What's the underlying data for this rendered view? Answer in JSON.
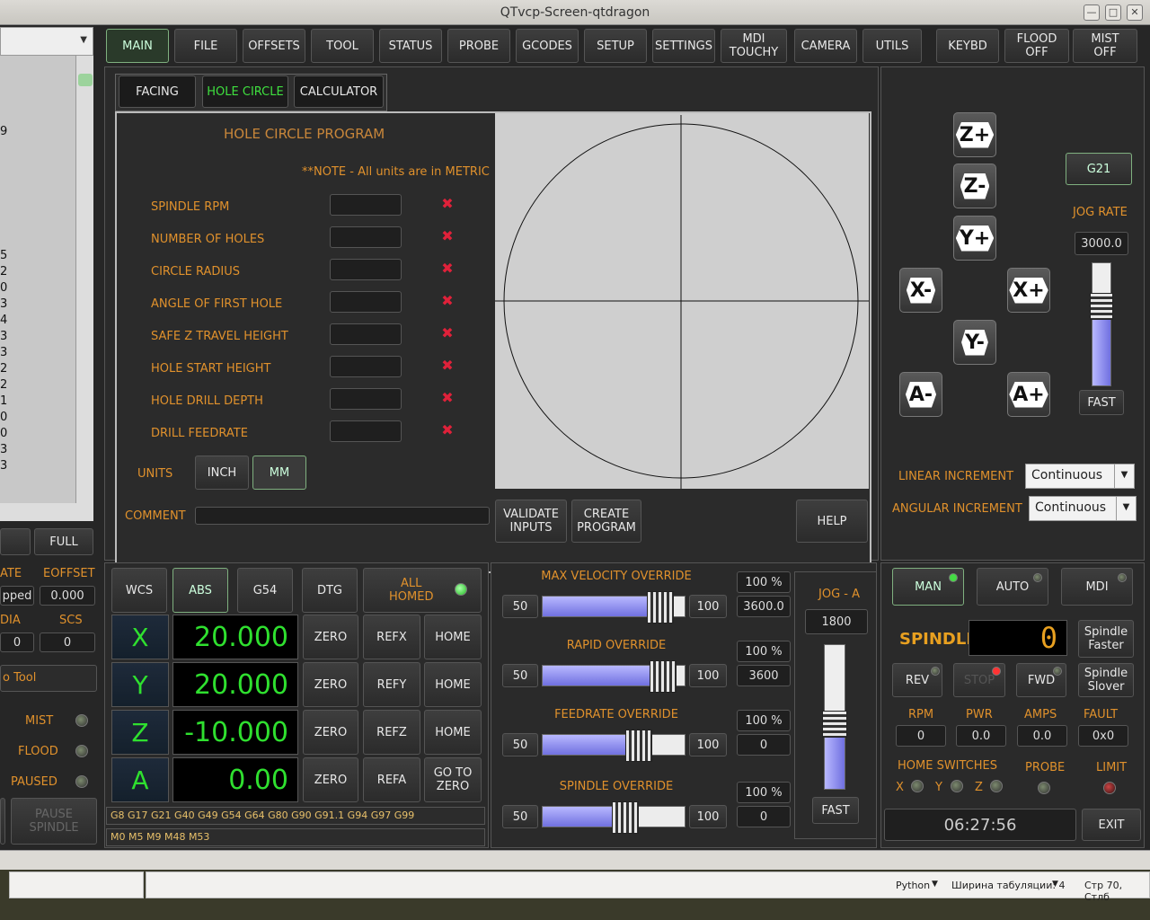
{
  "window": {
    "title": "QTvcp-Screen-qtdragon",
    "min": "—",
    "max": "□",
    "close": "✕"
  },
  "nav": [
    {
      "label": "MAIN",
      "on": true
    },
    {
      "label": "FILE"
    },
    {
      "label": "OFFSETS"
    },
    {
      "label": "TOOL"
    },
    {
      "label": "STATUS"
    },
    {
      "label": "PROBE"
    },
    {
      "label": "GCODES"
    },
    {
      "label": "SETUP"
    },
    {
      "label": "SETTINGS"
    },
    {
      "label": "MDI\nTOUCHY"
    },
    {
      "label": "CAMERA"
    },
    {
      "label": "UTILS"
    }
  ],
  "nav_right": {
    "keybd": "KEYBD",
    "flood": "FLOOD\nOFF",
    "mist": "MIST\nOFF"
  },
  "tabs": {
    "facing": "FACING",
    "hole_circle": "HOLE CIRCLE",
    "calculator": "CALCULATOR"
  },
  "hole": {
    "title": "HOLE CIRCLE PROGRAM",
    "note": "**NOTE - All units are in METRIC",
    "params": [
      "SPINDLE RPM",
      "NUMBER OF HOLES",
      "CIRCLE RADIUS",
      "ANGLE OF FIRST HOLE",
      "SAFE Z TRAVEL HEIGHT",
      "HOLE START HEIGHT",
      "HOLE DRILL DEPTH",
      "DRILL FEEDRATE"
    ],
    "invalid_mark": "✖",
    "units_label": "UNITS",
    "inch": "INCH",
    "mm": "MM",
    "comment_label": "COMMENT",
    "validate": "VALIDATE\nINPUTS",
    "create": "CREATE\nPROGRAM",
    "help": "HELP"
  },
  "left": {
    "full": "FULL",
    "rate_label": "ATE",
    "eoffset_label": "EOFFSET",
    "rate_value": "pped",
    "eoffset_value": "0.000",
    "dia_label": "DIA",
    "scs_label": "SCS",
    "dia_value": "0",
    "scs_value": "0",
    "tool": "o Tool",
    "mist": "MIST",
    "flood": "FLOOD",
    "paused": "PAUSED",
    "pause_spindle": "PAUSE\nSPINDLE",
    "numbers": [
      "9",
      "5",
      "2",
      "0",
      "3",
      "4",
      "3",
      "3",
      "2",
      "2",
      "1",
      "0",
      "0",
      "3",
      "3"
    ]
  },
  "dro": {
    "wcs": "WCS",
    "abs": "ABS",
    "g54": "G54",
    "dtg": "DTG",
    "homed": "ALL\nHOMED",
    "axes": [
      {
        "name": "X",
        "value": "20.000",
        "ref": "REFX",
        "last": "HOME"
      },
      {
        "name": "Y",
        "value": "20.000",
        "ref": "REFY",
        "last": "HOME"
      },
      {
        "name": "Z",
        "value": "-10.000",
        "ref": "REFZ",
        "last": "HOME"
      },
      {
        "name": "A",
        "value": "0.00",
        "ref": "REFA",
        "last": "GO TO\nZERO"
      }
    ],
    "zero": "ZERO",
    "gcodes": "G8 G17 G21 G40 G49 G54 G64 G80 G90 G91.1 G94 G97 G99",
    "mcodes": "M0 M5 M9 M48 M53"
  },
  "overrides": [
    {
      "label": "MAX VELOCITY OVERRIDE",
      "min": "50",
      "max": "100",
      "pct": "100 %",
      "val": "3600.0",
      "level": 0.83
    },
    {
      "label": "RAPID OVERRIDE",
      "min": "50",
      "max": "100",
      "pct": "100 %",
      "val": "3600",
      "level": 0.85
    },
    {
      "label": "FEEDRATE OVERRIDE",
      "min": "50",
      "max": "100",
      "pct": "100 %",
      "val": "0",
      "level": 0.68
    },
    {
      "label": "SPINDLE OVERRIDE",
      "min": "50",
      "max": "100",
      "pct": "100 %",
      "val": "0",
      "level": 0.58
    }
  ],
  "jog_a": {
    "label": "JOG - A",
    "value": "1800",
    "fast": "FAST",
    "level": 0.45
  },
  "jog": {
    "units": "G21",
    "rate_label": "JOG RATE",
    "rate": "3000.0",
    "fast": "FAST",
    "level": 0.65,
    "zp": "Z+",
    "zm": "Z-",
    "yp": "Y+",
    "ym": "Y-",
    "xm": "X-",
    "xp": "X+",
    "am": "A-",
    "ap": "A+",
    "lin_label": "LINEAR INCREMENT",
    "lin": "Continuous",
    "ang_label": "ANGULAR INCREMENT",
    "ang": "Continuous"
  },
  "mode": {
    "man": "MAN",
    "auto": "AUTO",
    "mdi": "MDI"
  },
  "spindle": {
    "label": "SPINDLE",
    "rpm_display": "0",
    "faster": "Spindle\nFaster",
    "slower": "Spindle\nSlover",
    "rev": "REV",
    "stop": "STOP",
    "fwd": "FWD",
    "rpm_label": "RPM",
    "pwr_label": "PWR",
    "amps_label": "AMPS",
    "fault_label": "FAULT",
    "rpm": "0",
    "pwr": "0.0",
    "amps": "0.0",
    "fault": "0x0",
    "home_label": "HOME SWITCHES",
    "probe_label": "PROBE",
    "limit_label": "LIMIT",
    "hx": "X",
    "hy": "Y",
    "hz": "Z"
  },
  "clock": "06:27:56",
  "exit": "EXIT",
  "status": {
    "lang": "Python",
    "tab": "Ширина табуляции: 4",
    "pos": "Стр 70, Стлб"
  },
  "colors": {
    "accent": "#e0912c",
    "dro_green": "#2fe02f",
    "invalid": "#e0213a",
    "led_on": "#44dd44"
  }
}
